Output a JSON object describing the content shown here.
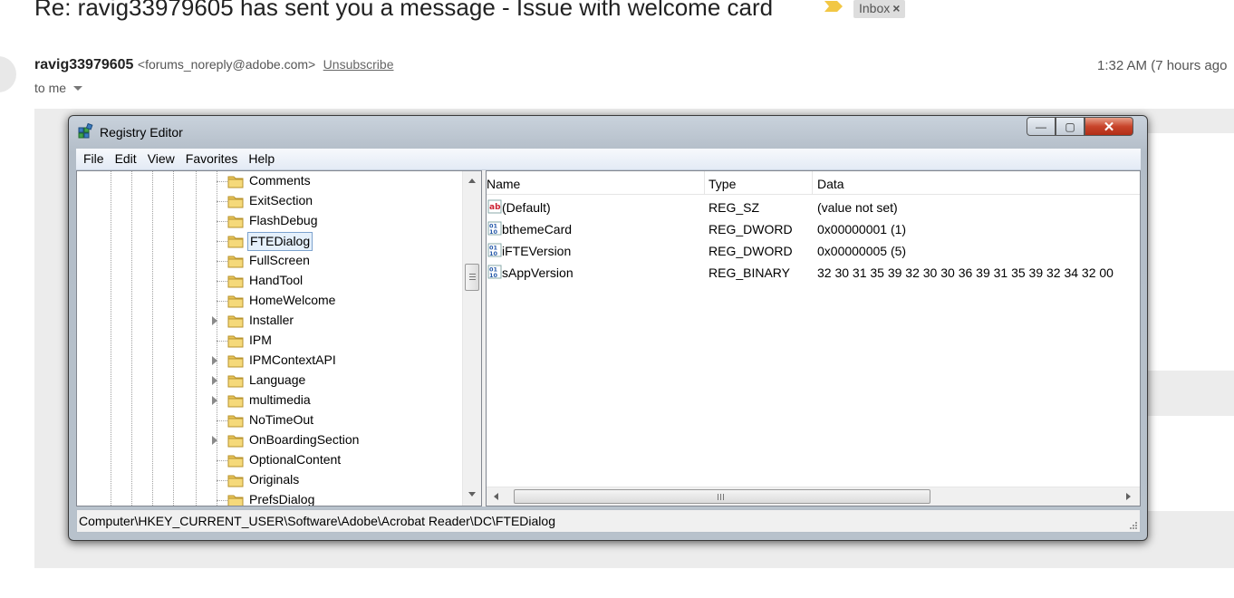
{
  "email": {
    "subject": "Re: ravig33979605 has sent you a message - Issue with welcome card",
    "label": "Inbox",
    "label_remove": "×",
    "sender_name": "ravig33979605",
    "sender_email": "<forums_noreply@adobe.com>",
    "unsubscribe": "Unsubscribe",
    "time": "1:32 AM (7 hours ago",
    "to": "to me"
  },
  "regedit": {
    "title": "Registry Editor",
    "menu": [
      "File",
      "Edit",
      "View",
      "Favorites",
      "Help"
    ],
    "tree": [
      {
        "label": "Comments",
        "expandable": false,
        "selected": false
      },
      {
        "label": "ExitSection",
        "expandable": false,
        "selected": false
      },
      {
        "label": "FlashDebug",
        "expandable": false,
        "selected": false
      },
      {
        "label": "FTEDialog",
        "expandable": false,
        "selected": true
      },
      {
        "label": "FullScreen",
        "expandable": false,
        "selected": false
      },
      {
        "label": "HandTool",
        "expandable": false,
        "selected": false
      },
      {
        "label": "HomeWelcome",
        "expandable": false,
        "selected": false
      },
      {
        "label": "Installer",
        "expandable": true,
        "selected": false
      },
      {
        "label": "IPM",
        "expandable": false,
        "selected": false
      },
      {
        "label": "IPMContextAPI",
        "expandable": true,
        "selected": false
      },
      {
        "label": "Language",
        "expandable": true,
        "selected": false
      },
      {
        "label": "multimedia",
        "expandable": true,
        "selected": false
      },
      {
        "label": "NoTimeOut",
        "expandable": false,
        "selected": false
      },
      {
        "label": "OnBoardingSection",
        "expandable": true,
        "selected": false
      },
      {
        "label": "OptionalContent",
        "expandable": false,
        "selected": false
      },
      {
        "label": "Originals",
        "expandable": false,
        "selected": false
      },
      {
        "label": "PrefsDialog",
        "expandable": false,
        "selected": false
      }
    ],
    "columns": {
      "name": "Name",
      "type": "Type",
      "data": "Data"
    },
    "values": [
      {
        "icon": "string-value-icon",
        "name": "(Default)",
        "type": "REG_SZ",
        "data": "(value not set)"
      },
      {
        "icon": "binary-value-icon",
        "name": "bthemeCard",
        "type": "REG_DWORD",
        "data": "0x00000001 (1)"
      },
      {
        "icon": "binary-value-icon",
        "name": "iFTEVersion",
        "type": "REG_DWORD",
        "data": "0x00000005 (5)"
      },
      {
        "icon": "binary-value-icon",
        "name": "sAppVersion",
        "type": "REG_BINARY",
        "data": "32 30 31 35 39 32 30 30 36 39 31 35 39 32 34 32 00"
      }
    ],
    "status_path": "Computer\\HKEY_CURRENT_USER\\Software\\Adobe\\Acrobat Reader\\DC\\FTEDialog",
    "buttons": {
      "minimize": "—",
      "maximize": "▢",
      "close": "✕"
    }
  },
  "colors": {
    "folder": "#e9c65a",
    "close": "#c8452b",
    "titlebar": "#c1cbd6"
  }
}
